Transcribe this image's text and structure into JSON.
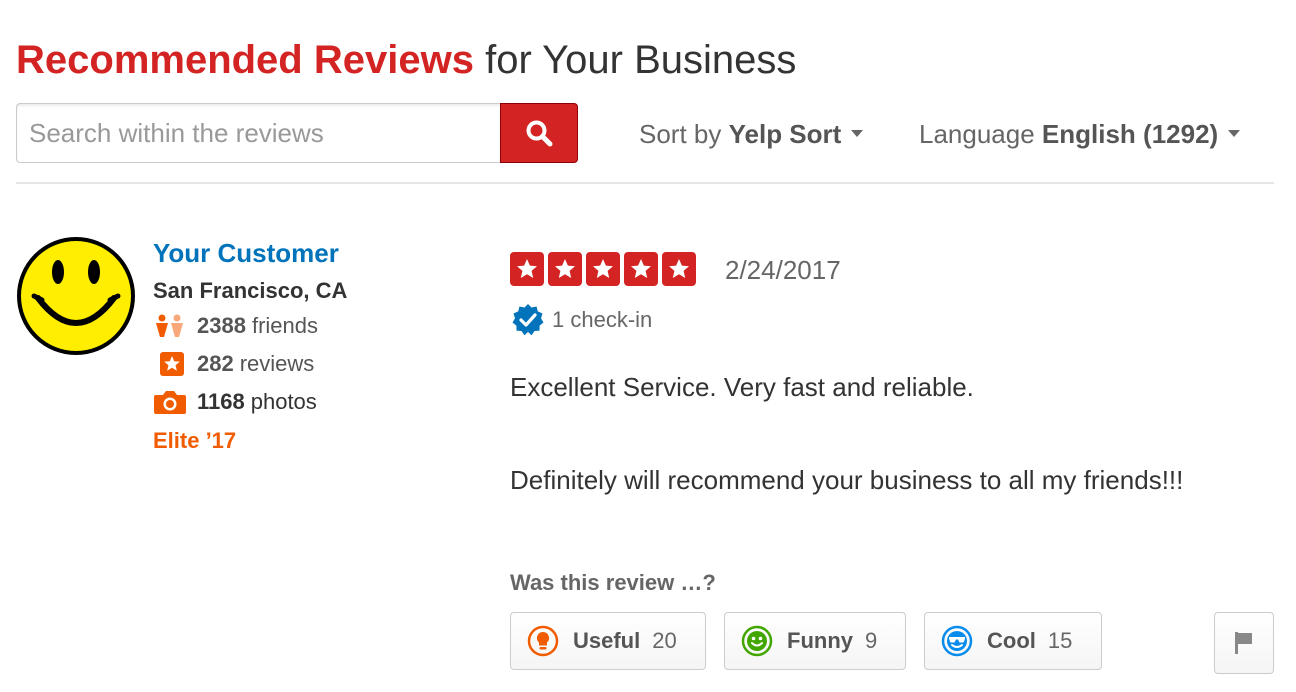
{
  "header": {
    "title_highlight": "Recommended Reviews",
    "title_rest": "for Your Business"
  },
  "search": {
    "placeholder": "Search within the reviews",
    "value": "",
    "button_icon": "search-icon"
  },
  "sort": {
    "label": "Sort by",
    "value": "Yelp Sort"
  },
  "language": {
    "label": "Language",
    "value": "English (1292)"
  },
  "reviewer": {
    "avatar_icon": "smiley-face-avatar",
    "name": "Your Customer",
    "location": "San Francisco, CA",
    "friends_count": "2388",
    "friends_label": "friends",
    "reviews_count": "282",
    "reviews_label": "reviews",
    "photos_count": "1168",
    "photos_label": "photos",
    "elite": "Elite ’17"
  },
  "review": {
    "rating": 5,
    "max_rating": 5,
    "date": "2/24/2017",
    "checkin": "1 check-in",
    "paragraphs": [
      "Excellent Service. Very fast and reliable.",
      "Definitely will recommend your business to all my friends!!!"
    ]
  },
  "votes": {
    "question": "Was this review …?",
    "useful_label": "Useful",
    "useful_count": "20",
    "funny_label": "Funny",
    "funny_count": "9",
    "cool_label": "Cool",
    "cool_count": "15",
    "flag_icon": "flag-icon"
  },
  "colors": {
    "brand_red": "#d32323",
    "link_blue": "#0073bb",
    "elite_orange": "#f15c00",
    "useful_orange": "#f15c00",
    "funny_green": "#41a700",
    "cool_blue": "#0a8ced"
  }
}
